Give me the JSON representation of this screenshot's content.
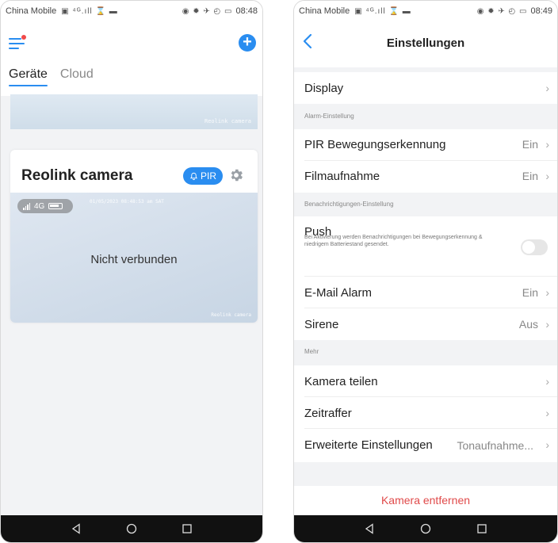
{
  "left_phone": {
    "status": {
      "carrier": "China Mobile",
      "signal_icons": "▣ ⁴ᴳ.ıll ⌛ ▬",
      "right_icons": "◉ ✹ ✈ ◴ ▭",
      "time": "08:48"
    },
    "tabs": [
      {
        "label": "Geräte"
      },
      {
        "label": "Cloud"
      }
    ],
    "camera_card": {
      "name": "Reolink camera",
      "pir_badge": "PIR",
      "network": "4G",
      "offline_label": "Nicht verbunden",
      "overlay_timestamp": "01/05/2023 08:48:53 am SAT",
      "overlay_watermark": "Reolink camera"
    },
    "strip_watermark": "Reolink camera"
  },
  "right_phone": {
    "status": {
      "carrier": "China Mobile",
      "signal_icons": "▣ ⁴ᴳ.ıll ⌛ ▬",
      "right_icons": "◉ ✹ ✈ ◴ ▭",
      "time": "08:49"
    },
    "title": "Einstellungen",
    "rows": {
      "display": {
        "label": "Display"
      },
      "alarm_section": "Alarm-Einstellung",
      "pir": {
        "label": "PIR Bewegungserkennung",
        "value": "Ein"
      },
      "recording": {
        "label": "Filmaufnahme",
        "value": "Ein"
      },
      "notify_section": "Benachrichtigungen-Einstellung",
      "push": {
        "label": "Push",
        "desc": "Bei Aktivierung werden Benachrichtigungen bei Bewegungserkennung & niedrigem Batteriestand gesendet.",
        "enabled": false
      },
      "email": {
        "label": "E-Mail Alarm",
        "value": "Ein"
      },
      "siren": {
        "label": "Sirene",
        "value": "Aus"
      },
      "more_section": "Mehr",
      "share": {
        "label": "Kamera teilen"
      },
      "timelapse": {
        "label": "Zeitraffer"
      },
      "advanced": {
        "label": "Erweiterte Einstellungen",
        "value": "Tonaufnahme..."
      }
    },
    "remove_button": "Kamera entfernen"
  },
  "colors": {
    "accent": "#2a8df0",
    "danger": "#e04a4a",
    "badge_dot": "#f04a4a"
  }
}
